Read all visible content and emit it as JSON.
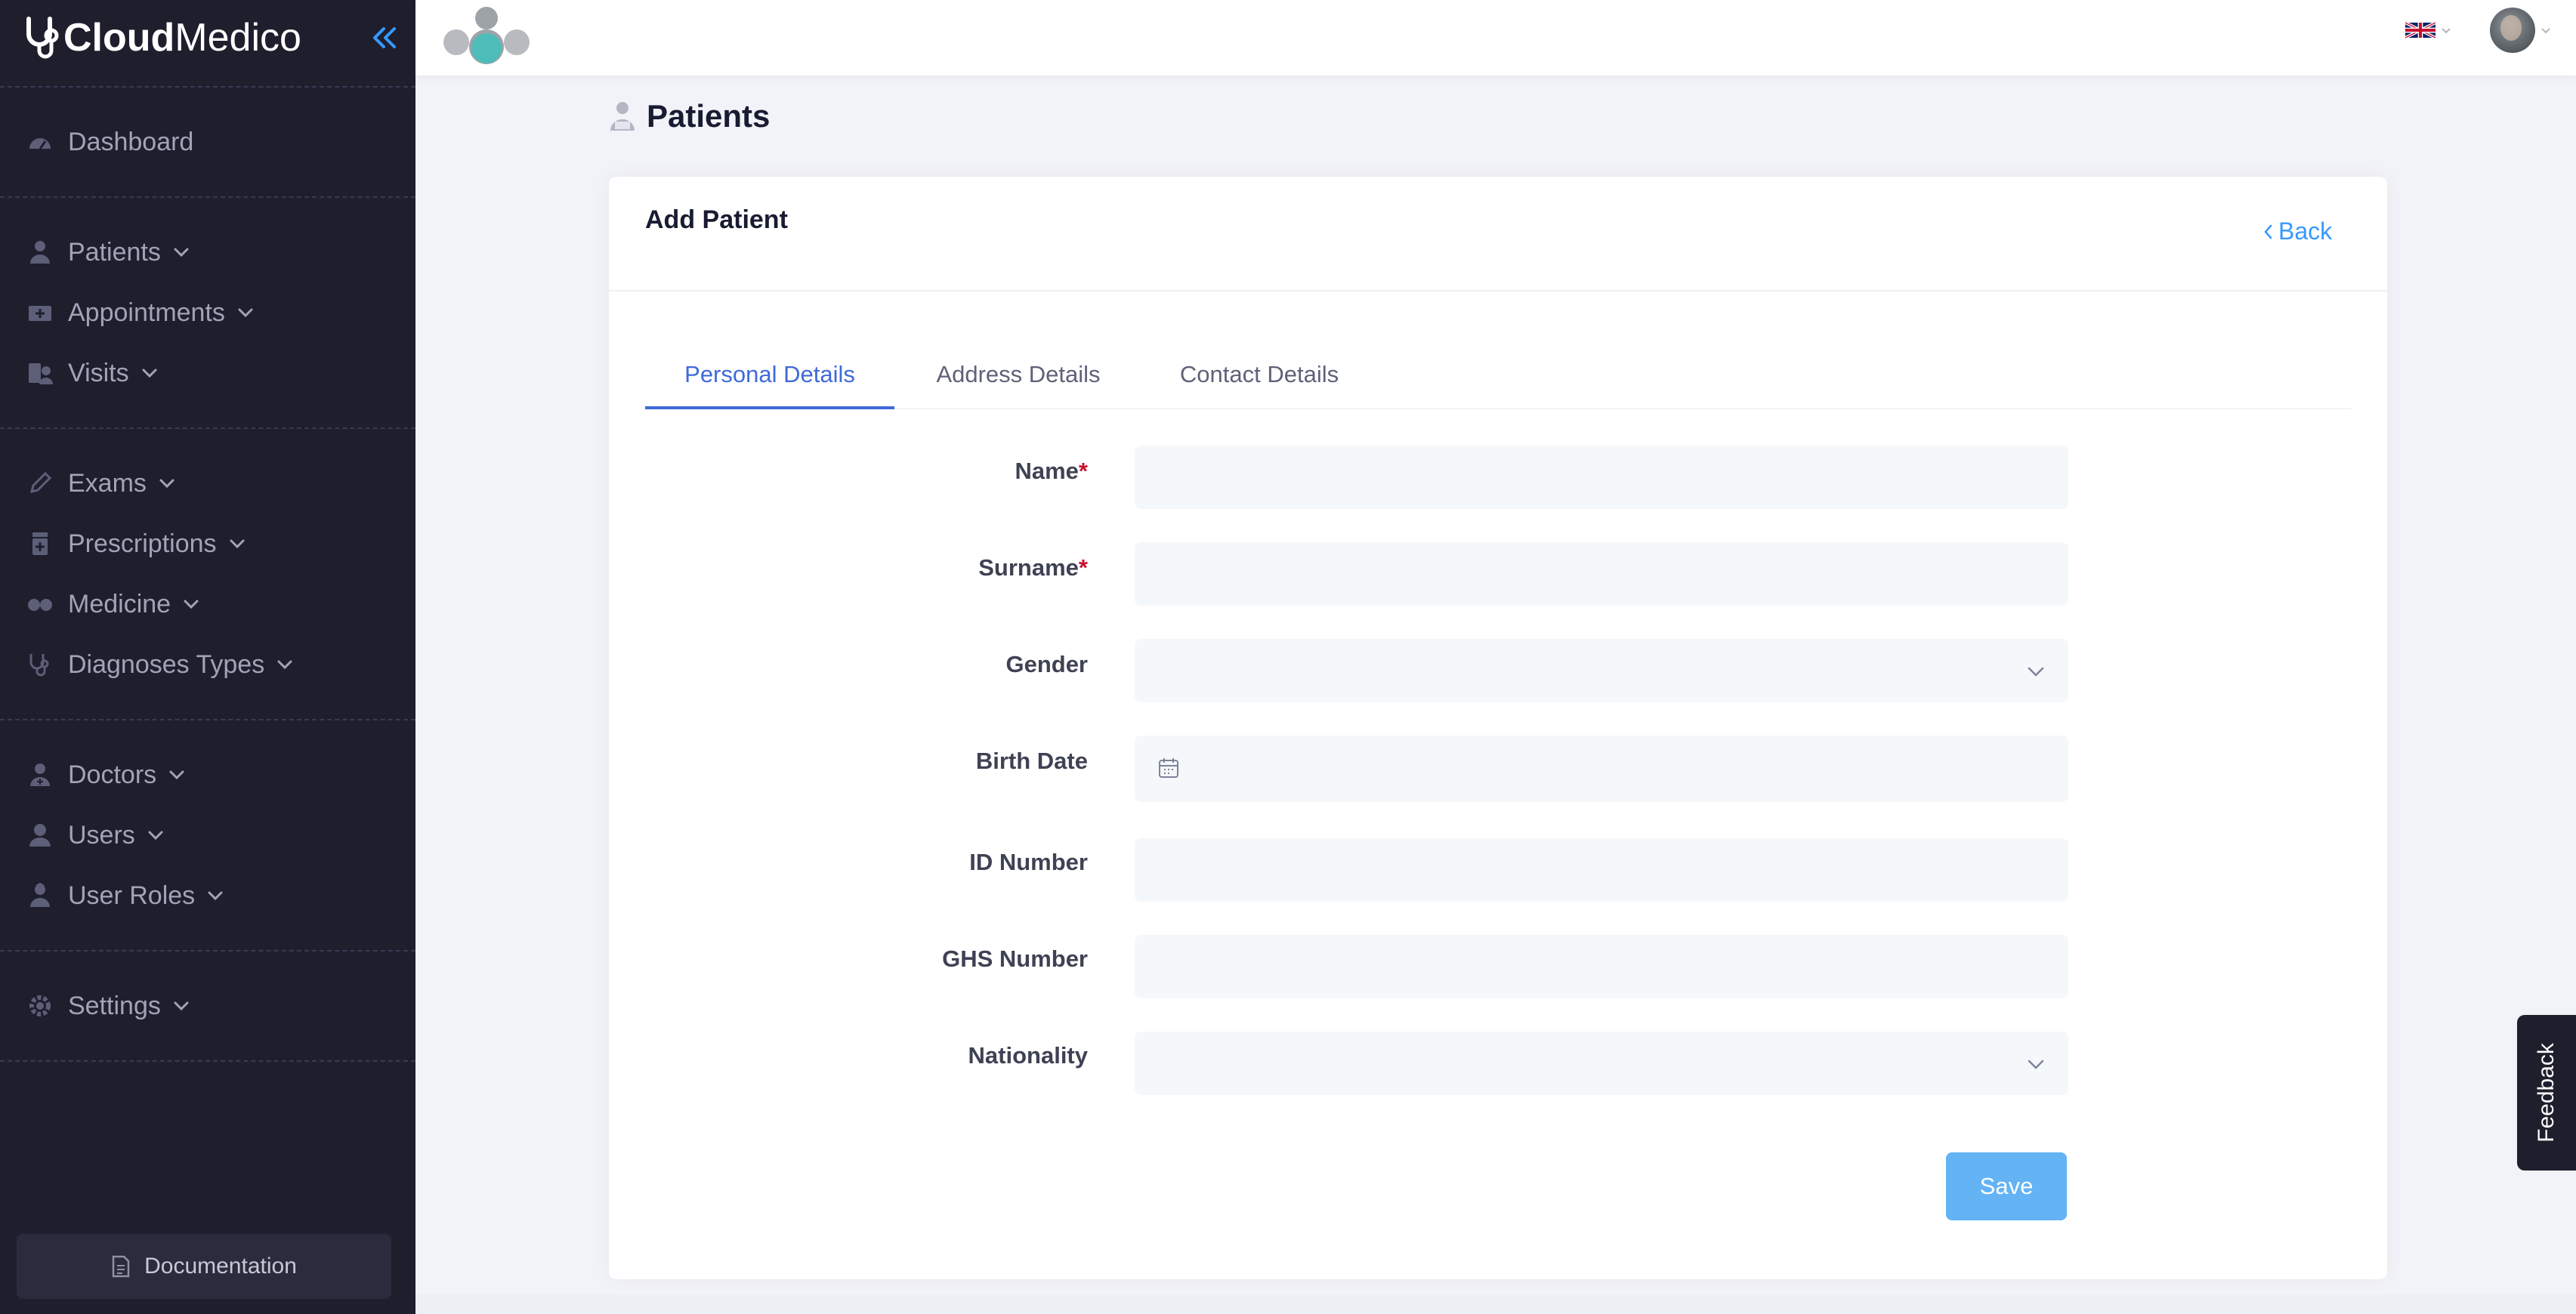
{
  "brand": {
    "bold": "Cloud",
    "light": "Medico"
  },
  "sidebar": {
    "items": [
      {
        "label": "Dashboard",
        "icon": "dashboard-icon"
      },
      {
        "label": "Patients",
        "icon": "patient-icon"
      },
      {
        "label": "Appointments",
        "icon": "appointment-icon"
      },
      {
        "label": "Visits",
        "icon": "visits-icon"
      },
      {
        "label": "Exams",
        "icon": "pencil-icon"
      },
      {
        "label": "Prescriptions",
        "icon": "prescription-icon"
      },
      {
        "label": "Medicine",
        "icon": "pills-icon"
      },
      {
        "label": "Diagnoses Types",
        "icon": "stethoscope-icon"
      },
      {
        "label": "Doctors",
        "icon": "doctor-icon"
      },
      {
        "label": "Users",
        "icon": "user-icon"
      },
      {
        "label": "User Roles",
        "icon": "user-role-icon"
      },
      {
        "label": "Settings",
        "icon": "gear-icon"
      }
    ],
    "documentation_label": "Documentation"
  },
  "header": {
    "language": "en-GB",
    "user_avatar": "avatar"
  },
  "page": {
    "title": "Patients"
  },
  "card": {
    "title": "Add Patient",
    "back_label": "Back",
    "tabs": [
      "Personal Details",
      "Address Details",
      "Contact Details"
    ],
    "active_tab": "Personal Details"
  },
  "form": {
    "fields": [
      {
        "label": "Name",
        "required": "*",
        "value": ""
      },
      {
        "label": "Surname",
        "required": "*",
        "value": ""
      },
      {
        "label": "Gender",
        "value": ""
      },
      {
        "label": "Birth Date",
        "value": ""
      },
      {
        "label": "ID Number",
        "value": ""
      },
      {
        "label": "GHS Number",
        "value": ""
      },
      {
        "label": "Nationality",
        "value": ""
      }
    ],
    "save_label": "Save"
  },
  "feedback_label": "Feedback",
  "colors": {
    "sidebar_bg": "#1e1e2d",
    "accent": "#3f6ad8",
    "link": "#3699ff",
    "save_button": "#63b3f5",
    "required": "#c8102e"
  }
}
